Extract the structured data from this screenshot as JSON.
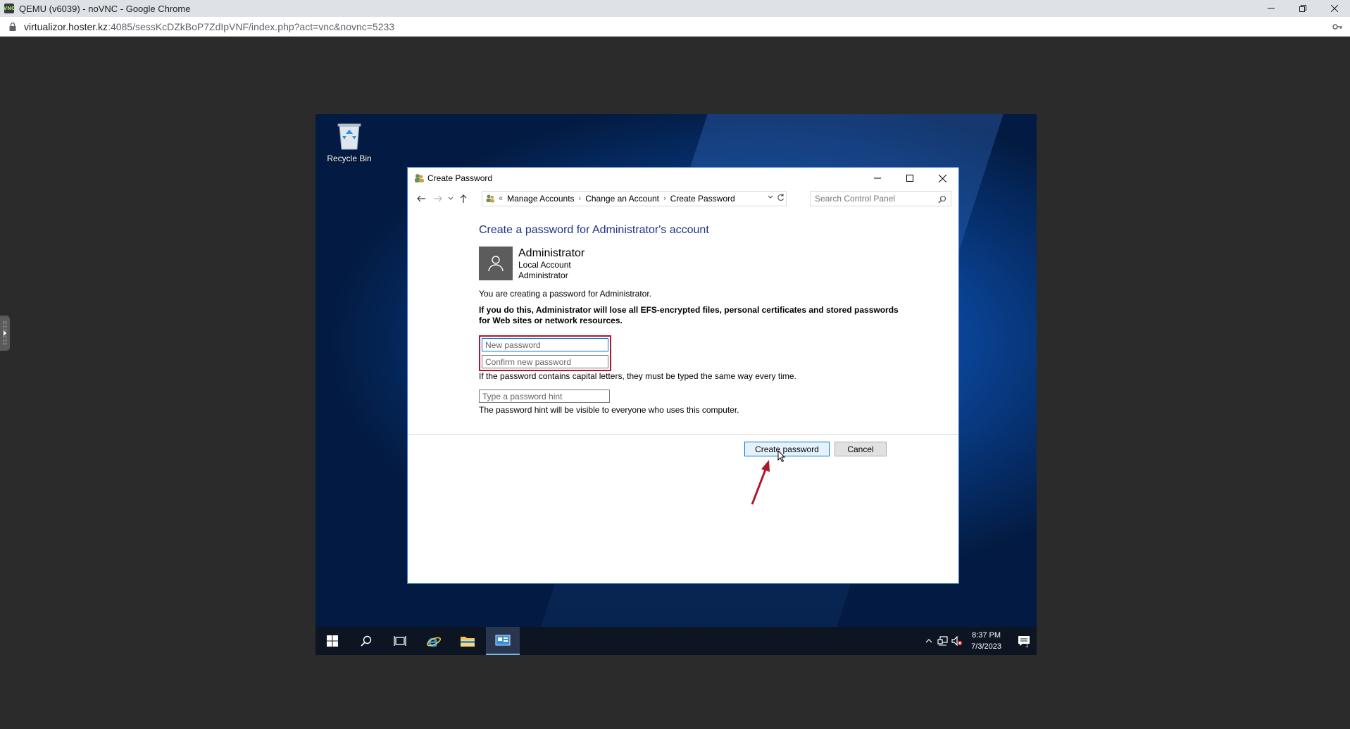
{
  "browser": {
    "window_title": "QEMU (v6039) - noVNC - Google Chrome",
    "favicon_text": "VNC",
    "url_host": "virtualizor.hoster.kz",
    "url_rest": ":4085/sessKcDZkBoP7ZdIpVNF/index.php?act=vnc&novnc=5233"
  },
  "desktop": {
    "recycle_bin_label": "Recycle Bin"
  },
  "dialog": {
    "title": "Create Password",
    "breadcrumb": {
      "overflow": "«",
      "items": [
        "Manage Accounts",
        "Change an Account",
        "Create Password"
      ]
    },
    "search_placeholder": "Search Control Panel",
    "heading": "Create a password for Administrator's account",
    "account": {
      "name": "Administrator",
      "type": "Local Account",
      "role": "Administrator"
    },
    "message": "You are creating a password for Administrator.",
    "warning_line1": "If you do this, Administrator will lose all EFS-encrypted files, personal certificates and stored passwords",
    "warning_line2": "for Web sites or network resources.",
    "new_password_placeholder": "New password",
    "confirm_password_placeholder": "Confirm new password",
    "caps_note": "If the password contains capital letters, they must be typed the same way every time.",
    "hint_placeholder": "Type a password hint",
    "hint_note": "The password hint will be visible to everyone who uses this computer.",
    "create_button": "Create password",
    "cancel_button": "Cancel"
  },
  "taskbar": {
    "time": "8:37 PM",
    "date": "7/3/2023",
    "notification_count": "1"
  },
  "colors": {
    "annotation_red": "#b0172b",
    "heading_blue": "#1e3287",
    "accent_blue": "#0078d7"
  }
}
